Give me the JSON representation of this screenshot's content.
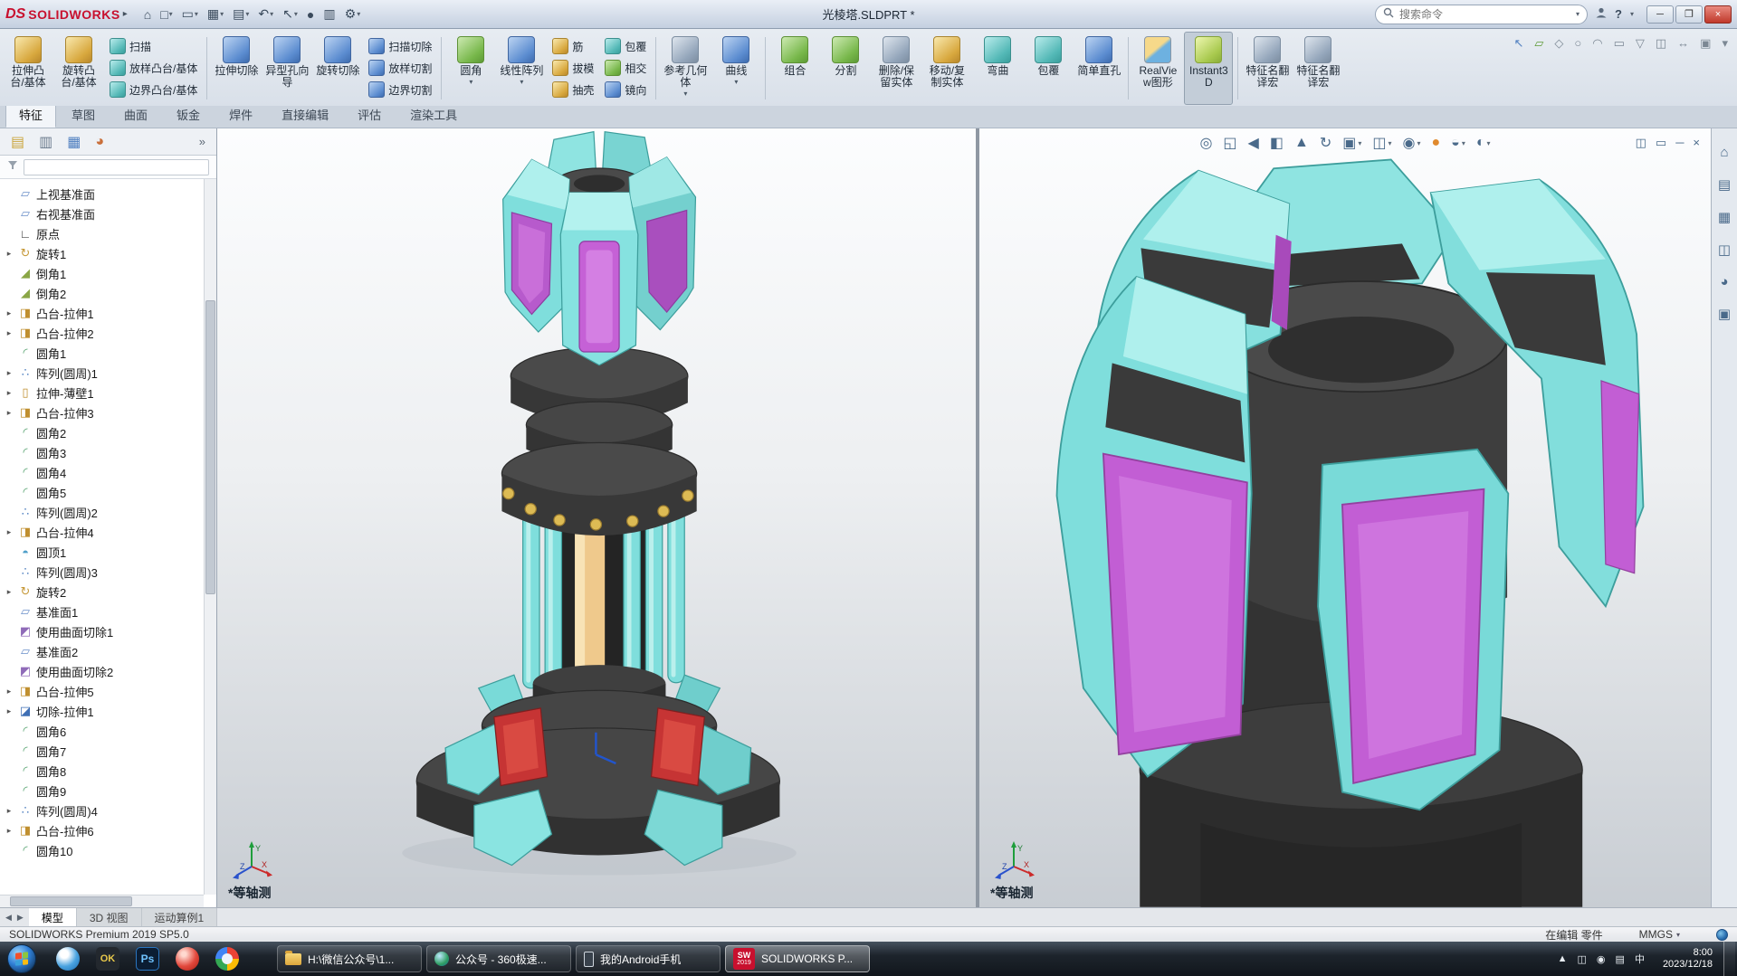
{
  "titlebar": {
    "brand_prefix": "DS",
    "brand": "SOLIDWORKS",
    "menu_arrow": "▸",
    "title": "光棱塔.SLDPRT *",
    "search_placeholder": "搜索命令",
    "qat": [
      {
        "name": "home-icon",
        "glyph": "⌂"
      },
      {
        "name": "new-document-icon",
        "glyph": "□",
        "arrow": true
      },
      {
        "name": "open-icon",
        "glyph": "▭",
        "arrow": true
      },
      {
        "name": "save-icon",
        "glyph": "▦",
        "arrow": true
      },
      {
        "name": "print-icon",
        "glyph": "▤",
        "arrow": true
      },
      {
        "name": "undo-icon",
        "glyph": "↶",
        "arrow": true
      },
      {
        "name": "select-icon",
        "glyph": "↖",
        "arrow": true
      },
      {
        "name": "rebuild-icon",
        "glyph": "●"
      },
      {
        "name": "file-properties-icon",
        "glyph": "▥"
      },
      {
        "name": "options-icon",
        "glyph": "⚙",
        "arrow": true
      }
    ],
    "help_label": "?",
    "window_controls": [
      {
        "name": "minimize-button",
        "glyph": "─"
      },
      {
        "name": "restore-button",
        "glyph": "❐"
      },
      {
        "name": "close-button",
        "glyph": "×"
      }
    ]
  },
  "ribbon": {
    "legacy_icons": [
      {
        "name": "select-tool-icon",
        "glyph": "↖"
      },
      {
        "name": "sketch-tool-icon",
        "glyph": "▱"
      },
      {
        "name": "dimension-tool-icon",
        "glyph": "◇"
      },
      {
        "name": "circle-tool-icon",
        "glyph": "○"
      },
      {
        "name": "arc-tool-icon",
        "glyph": "◠"
      },
      {
        "name": "rectangle-tool-icon",
        "glyph": "▭"
      },
      {
        "name": "polygon-tool-icon",
        "glyph": "▽"
      },
      {
        "name": "mirror-tool-icon",
        "glyph": "◫"
      },
      {
        "name": "move-tool-icon",
        "glyph": "↔"
      },
      {
        "name": "grid-tool-icon",
        "glyph": "▣"
      },
      {
        "name": "filter-tool-icon",
        "glyph": "▾"
      }
    ],
    "items": [
      {
        "kind": "large",
        "name": "extruded-boss-button",
        "label": "拉伸凸台/基体",
        "tone": "gold"
      },
      {
        "kind": "large",
        "name": "revolved-boss-button",
        "label": "旋转凸台/基体",
        "tone": "gold"
      },
      {
        "kind": "col",
        "items": [
          {
            "name": "swept-boss-button",
            "label": "扫描",
            "tone": "teal"
          },
          {
            "name": "lofted-boss-button",
            "label": "放样凸台/基体",
            "tone": "teal"
          },
          {
            "name": "boundary-boss-button",
            "label": "边界凸台/基体",
            "tone": "teal"
          }
        ]
      },
      {
        "kind": "sep"
      },
      {
        "kind": "large",
        "name": "extruded-cut-button",
        "label": "拉伸切除",
        "tone": "blue"
      },
      {
        "kind": "large",
        "name": "hole-wizard-button",
        "label": "异型孔向导",
        "tone": "blue"
      },
      {
        "kind": "large",
        "name": "revolved-cut-button",
        "label": "旋转切除",
        "tone": "blue"
      },
      {
        "kind": "col",
        "items": [
          {
            "name": "swept-cut-button",
            "label": "扫描切除",
            "tone": "blue"
          },
          {
            "name": "lofted-cut-button",
            "label": "放样切割",
            "tone": "blue"
          },
          {
            "name": "boundary-cut-button",
            "label": "边界切割",
            "tone": "blue"
          }
        ]
      },
      {
        "kind": "sep"
      },
      {
        "kind": "large",
        "name": "fillet-button",
        "label": "圆角",
        "tone": "green",
        "arrow": true
      },
      {
        "kind": "large",
        "name": "linear-pattern-button",
        "label": "线性阵列",
        "tone": "blue",
        "arrow": true
      },
      {
        "kind": "col",
        "items": [
          {
            "name": "rib-button",
            "label": "筋",
            "tone": "gold"
          },
          {
            "name": "draft-button",
            "label": "拔模",
            "tone": "gold"
          },
          {
            "name": "shell-button",
            "label": "抽壳",
            "tone": "gold"
          }
        ]
      },
      {
        "kind": "col",
        "items": [
          {
            "name": "wrap-button",
            "label": "包覆",
            "tone": "teal"
          },
          {
            "name": "intersect-button",
            "label": "相交",
            "tone": "green"
          },
          {
            "name": "mirror-button",
            "label": "镜向",
            "tone": "blue"
          }
        ]
      },
      {
        "kind": "sep"
      },
      {
        "kind": "large",
        "name": "reference-geometry-button",
        "label": "参考几何体",
        "tone": "slate",
        "arrow": true
      },
      {
        "kind": "large",
        "name": "curves-button",
        "label": "曲线",
        "tone": "blue",
        "arrow": true
      },
      {
        "kind": "sep"
      },
      {
        "kind": "large",
        "name": "combine-button",
        "label": "组合",
        "tone": "green"
      },
      {
        "kind": "large",
        "name": "split-button",
        "label": "分割",
        "tone": "green"
      },
      {
        "kind": "large",
        "name": "delete-keep-body-button",
        "label": "删除/保留实体",
        "tone": "slate"
      },
      {
        "kind": "large",
        "name": "move-copy-body-button",
        "label": "移动/复制实体",
        "tone": "gold"
      },
      {
        "kind": "large",
        "name": "flex-button",
        "label": "弯曲",
        "tone": "teal"
      },
      {
        "kind": "large",
        "name": "wrap-feature-button",
        "label": "包覆",
        "tone": "teal"
      },
      {
        "kind": "large",
        "name": "simple-hole-button",
        "label": "简单直孔",
        "tone": "blue"
      },
      {
        "kind": "sep"
      },
      {
        "kind": "large",
        "name": "realview-button",
        "label": "RealView图形",
        "tone": "multi"
      },
      {
        "kind": "large",
        "name": "instant3d-button",
        "label": "Instant3D",
        "tone": "lime",
        "active": true
      },
      {
        "kind": "sep"
      },
      {
        "kind": "large",
        "name": "feature-macro-button",
        "label": "特征名翻译宏",
        "tone": "slate"
      },
      {
        "kind": "large",
        "name": "feature-macro2-button",
        "label": "特征名翻译宏",
        "tone": "slate"
      }
    ]
  },
  "cm_tabs": {
    "items": [
      {
        "id": "features",
        "label": "特征",
        "active": true
      },
      {
        "id": "sketch",
        "label": "草图"
      },
      {
        "id": "surfaces",
        "label": "曲面"
      },
      {
        "id": "sheet-metal",
        "label": "钣金"
      },
      {
        "id": "weldments",
        "label": "焊件"
      },
      {
        "id": "direct-editing",
        "label": "直接编辑"
      },
      {
        "id": "evaluate",
        "label": "评估"
      },
      {
        "id": "render-tools",
        "label": "渲染工具"
      }
    ]
  },
  "panel": {
    "tabs": [
      {
        "name": "featuremanager-tab-icon",
        "glyph": "▤",
        "cls": "c-gold"
      },
      {
        "name": "propertymanager-tab-icon",
        "glyph": "▥",
        "cls": "c-slate"
      },
      {
        "name": "configurationmanager-tab-icon",
        "glyph": "▦",
        "cls": "c-blue"
      },
      {
        "name": "displaymanager-tab-icon",
        "glyph": "◕",
        "cls": "c-ball"
      }
    ],
    "chevron": "»"
  },
  "feature_tree": {
    "items": [
      {
        "glyph": "▱",
        "type": "plane",
        "label": "上视基准面"
      },
      {
        "glyph": "▱",
        "type": "plane",
        "label": "右视基准面"
      },
      {
        "glyph": "∟",
        "type": "origin",
        "label": "原点"
      },
      {
        "glyph": "↻",
        "type": "revolve",
        "label": "旋转1",
        "expand": true
      },
      {
        "glyph": "◢",
        "type": "chamfer",
        "label": "倒角1"
      },
      {
        "glyph": "◢",
        "type": "chamfer",
        "label": "倒角2"
      },
      {
        "glyph": "◨",
        "type": "extrude",
        "label": "凸台-拉伸1",
        "expand": true
      },
      {
        "glyph": "◨",
        "type": "extrude",
        "label": "凸台-拉伸2",
        "expand": true
      },
      {
        "glyph": "◜",
        "type": "fillet",
        "label": "圆角1"
      },
      {
        "glyph": "∴",
        "type": "pattern",
        "label": "阵列(圆周)1",
        "expand": true
      },
      {
        "glyph": "▯",
        "type": "thin",
        "label": "拉伸-薄壁1",
        "expand": true
      },
      {
        "glyph": "◨",
        "type": "extrude",
        "label": "凸台-拉伸3",
        "expand": true
      },
      {
        "glyph": "◜",
        "type": "fillet",
        "label": "圆角2"
      },
      {
        "glyph": "◜",
        "type": "fillet",
        "label": "圆角3"
      },
      {
        "glyph": "◜",
        "type": "fillet",
        "label": "圆角4"
      },
      {
        "glyph": "◜",
        "type": "fillet",
        "label": "圆角5"
      },
      {
        "glyph": "∴",
        "type": "pattern",
        "label": "阵列(圆周)2"
      },
      {
        "glyph": "◨",
        "type": "extrude",
        "label": "凸台-拉伸4",
        "expand": true
      },
      {
        "glyph": "◓",
        "type": "dome",
        "label": "圆顶1"
      },
      {
        "glyph": "∴",
        "type": "pattern",
        "label": "阵列(圆周)3"
      },
      {
        "glyph": "↻",
        "type": "revolve",
        "label": "旋转2",
        "expand": true
      },
      {
        "glyph": "▱",
        "type": "plane",
        "label": "基准面1"
      },
      {
        "glyph": "◩",
        "type": "surfcut",
        "label": "使用曲面切除1"
      },
      {
        "glyph": "▱",
        "type": "plane",
        "label": "基准面2"
      },
      {
        "glyph": "◩",
        "type": "surfcut",
        "label": "使用曲面切除2"
      },
      {
        "glyph": "◨",
        "type": "extrude",
        "label": "凸台-拉伸5",
        "expand": true
      },
      {
        "glyph": "◪",
        "type": "cut",
        "label": "切除-拉伸1",
        "expand": true
      },
      {
        "glyph": "◜",
        "type": "fillet",
        "label": "圆角6"
      },
      {
        "glyph": "◜",
        "type": "fillet",
        "label": "圆角7"
      },
      {
        "glyph": "◜",
        "type": "fillet",
        "label": "圆角8"
      },
      {
        "glyph": "◜",
        "type": "fillet",
        "label": "圆角9"
      },
      {
        "glyph": "∴",
        "type": "pattern",
        "label": "阵列(圆周)4",
        "expand": true
      },
      {
        "glyph": "◨",
        "type": "extrude",
        "label": "凸台-拉伸6",
        "expand": true
      },
      {
        "glyph": "◜",
        "type": "fillet",
        "label": "圆角10"
      }
    ]
  },
  "viewports": {
    "left_label": "*等轴测",
    "right_label": "*等轴测",
    "headsup": [
      {
        "name": "zoom-fit-icon",
        "glyph": "◎"
      },
      {
        "name": "zoom-area-icon",
        "glyph": "◱"
      },
      {
        "name": "previous-view-icon",
        "glyph": "◀"
      },
      {
        "name": "section-view-icon",
        "glyph": "◧"
      },
      {
        "name": "dynamic-annotation-icon",
        "glyph": "▲"
      },
      {
        "name": "rotate-view-icon",
        "glyph": "↻"
      },
      {
        "name": "view-orientation-icon",
        "glyph": "▣",
        "arrow": true
      },
      {
        "name": "display-style-icon",
        "glyph": "◫",
        "arrow": true
      },
      {
        "name": "hide-show-items-icon",
        "glyph": "◉",
        "arrow": true
      },
      {
        "name": "edit-appearance-icon",
        "glyph": "●",
        "color": "#e08a2e"
      },
      {
        "name": "apply-scene-icon",
        "glyph": "◒",
        "arrow": true
      },
      {
        "name": "view-settings-icon",
        "glyph": "◐",
        "arrow": true
      }
    ],
    "pane_controls": [
      {
        "name": "split-view-icon",
        "glyph": "◫"
      },
      {
        "name": "full-screen-icon",
        "glyph": "▭"
      },
      {
        "name": "collapse-pane-icon",
        "glyph": "─"
      },
      {
        "name": "close-pane-icon",
        "glyph": "×"
      }
    ]
  },
  "task_pane": {
    "icons": [
      {
        "name": "resources-icon",
        "glyph": "⌂"
      },
      {
        "name": "design-library-icon",
        "glyph": "▤"
      },
      {
        "name": "file-explorer-icon",
        "glyph": "▦"
      },
      {
        "name": "view-palette-icon",
        "glyph": "◫"
      },
      {
        "name": "appearances-icon",
        "glyph": "◕"
      },
      {
        "name": "custom-properties-icon",
        "glyph": "▣"
      }
    ]
  },
  "model_tabs": {
    "nav": [
      "◀",
      "▶"
    ],
    "items": [
      {
        "id": "model",
        "label": "模型",
        "active": true
      },
      {
        "id": "3d-views",
        "label": "3D 视图"
      },
      {
        "id": "motion-study-1",
        "label": "运动算例1"
      }
    ]
  },
  "statusbar": {
    "left": "SOLIDWORKS Premium 2019 SP5.0",
    "editing": "在编辑 零件",
    "units": "MMGS"
  },
  "taskbar": {
    "quick": [
      {
        "name": "browser-360",
        "style": "orb-blue"
      },
      {
        "name": "app-ok",
        "style": "sq-dark",
        "text": "OK"
      },
      {
        "name": "photoshop",
        "style": "sq-ps",
        "text": "Ps"
      },
      {
        "name": "music-app",
        "style": "orb-red"
      },
      {
        "name": "chrome-like",
        "style": "orb-multi"
      }
    ],
    "windows": [
      {
        "name": "explorer-window-button",
        "icon": "folder",
        "label": "H:\\微信公众号\\1..."
      },
      {
        "name": "browser-window-button",
        "icon": "globe",
        "label": "公众号 - 360极速..."
      },
      {
        "name": "android-window-button",
        "icon": "phone",
        "label": "我的Android手机"
      },
      {
        "name": "solidworks-window-button",
        "icon": "sw",
        "icon_text": "SW",
        "icon_sub": "2019",
        "label": "SOLIDWORKS P...",
        "active": true
      }
    ],
    "tray": [
      {
        "name": "hidden-icons-button",
        "glyph": "▲"
      },
      {
        "name": "tray-display-icon",
        "glyph": "◫"
      },
      {
        "name": "tray-volume-icon",
        "glyph": "◉"
      },
      {
        "name": "tray-network-icon",
        "glyph": "▤"
      },
      {
        "name": "tray-ime-icon",
        "glyph": "中"
      }
    ],
    "clock": {
      "time": "8:00",
      "date": "2023/12/18"
    }
  },
  "colors": {
    "brand_red": "#c8102e",
    "fin_cyan": "#7FDEDC",
    "fin_cyan_light": "#AFF0ED",
    "panel_magenta": "#C25ED4",
    "body_dark": "#3a3a3a",
    "stud_gold": "#DDBB54",
    "core_tan": "#EFC98C",
    "base_red_panel": "#C63434"
  }
}
